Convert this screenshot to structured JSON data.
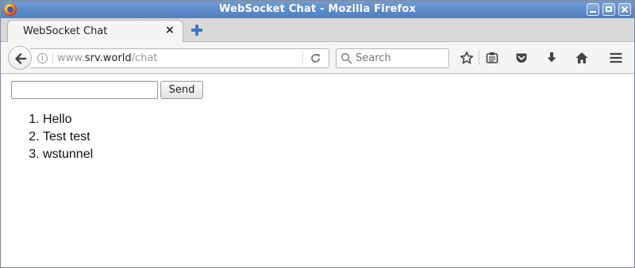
{
  "window": {
    "title": "WebSocket Chat - Mozilla Firefox"
  },
  "tabs": [
    {
      "label": "WebSocket Chat",
      "close": "×"
    }
  ],
  "navbar": {
    "url_prefix": "www.",
    "url_host": "srv.world",
    "url_path": "/chat",
    "search_placeholder": "Search"
  },
  "page": {
    "input_value": "",
    "send_label": "Send",
    "messages": [
      "Hello",
      "Test test",
      "wstunnel"
    ]
  },
  "colors": {
    "titlebar": "#5a89c8",
    "newtab_plus": "#3c78c8"
  },
  "icons": [
    "firefox-icon",
    "minimize-icon",
    "maximize-icon",
    "close-icon",
    "new-tab-icon",
    "back-icon",
    "info-icon",
    "reload-icon",
    "search-icon",
    "bookmark-star-icon",
    "reading-list-icon",
    "pocket-icon",
    "download-icon",
    "home-icon",
    "menu-icon"
  ]
}
